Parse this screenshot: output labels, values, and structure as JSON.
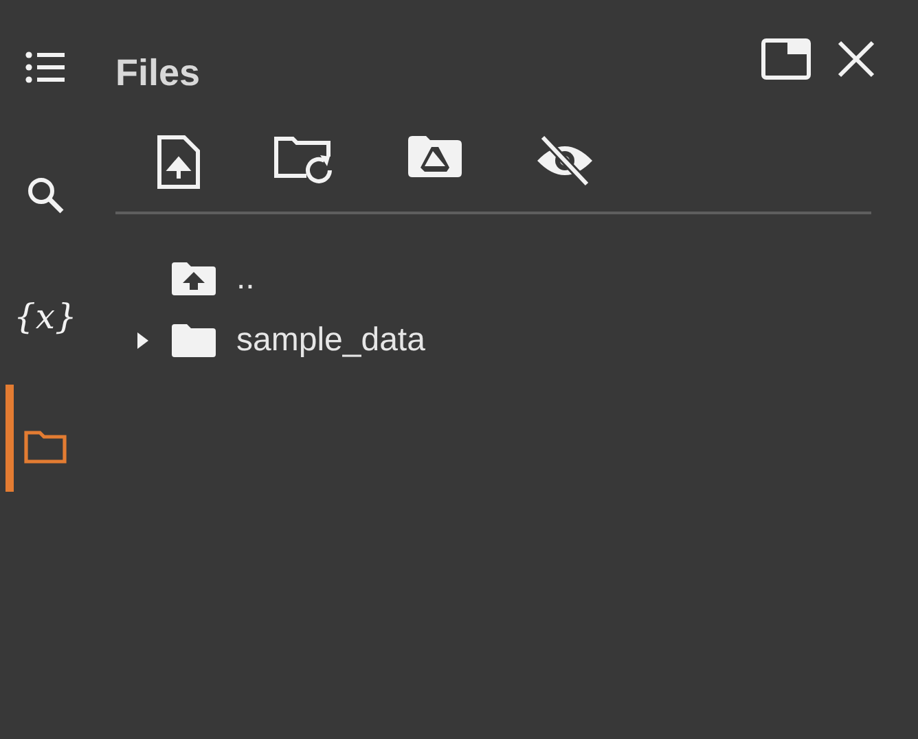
{
  "sidebar": {
    "items": [
      {
        "kind": "toc",
        "selected": false
      },
      {
        "kind": "search",
        "selected": false
      },
      {
        "kind": "variables",
        "glyph": "{x}",
        "selected": false
      },
      {
        "kind": "files",
        "selected": true
      }
    ]
  },
  "panel": {
    "title": "Files"
  },
  "toolbar": [
    {
      "kind": "upload"
    },
    {
      "kind": "refresh"
    },
    {
      "kind": "drive"
    },
    {
      "kind": "hide"
    }
  ],
  "tree": [
    {
      "kind": "parent",
      "name": ".."
    },
    {
      "kind": "folder",
      "name": "sample_data",
      "expanded": false
    }
  ]
}
